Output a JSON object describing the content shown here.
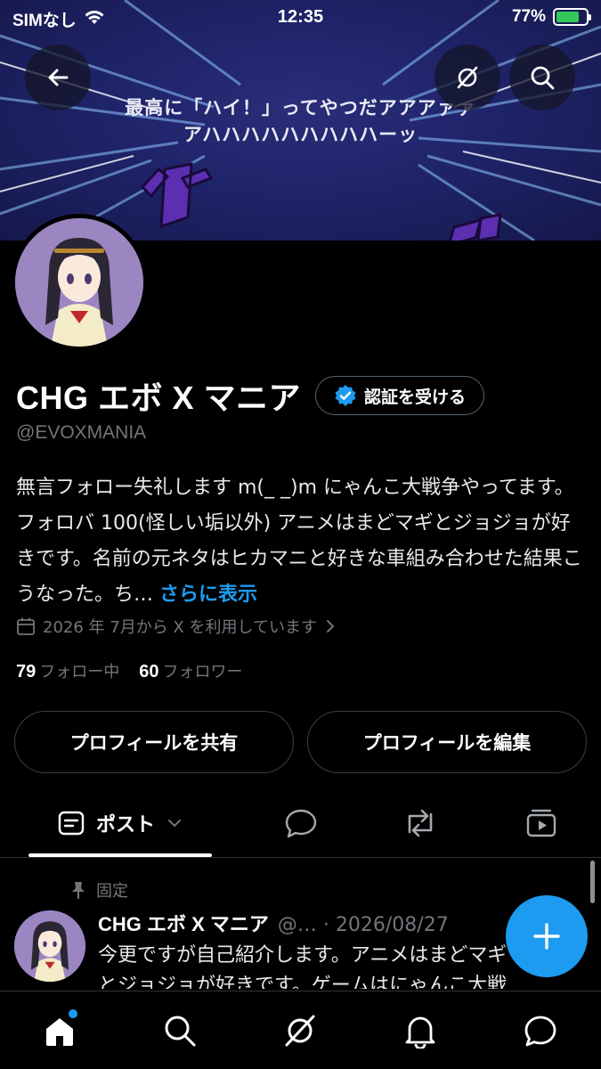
{
  "status_bar": {
    "carrier": "SIMなし",
    "time": "12:35",
    "battery": "77%",
    "battery_level": 0.77
  },
  "banner": {
    "line1": "最高に「ハイ！」ってやつだアアアァァ",
    "line2": "アハハハハハハハハハーッ",
    "sfx": "ドド"
  },
  "profile": {
    "display_name": "CHG エボ X マニア",
    "verify_label": "認証を受ける",
    "handle": "@EVOXMANIA",
    "bio": "無言フォロー失礼します m(_ _)m にゃんこ大戦争やってます。フォロバ 100(怪しい垢以外) アニメはまどマギとジョジョが好きです。名前の元ネタはヒカマニと好きな車組み合わせた結果こうなった。ち… ",
    "bio_more": "さらに表示",
    "joined": "2026 年 7月から X を利用しています",
    "following_count": "79",
    "following_label": "フォロー中",
    "followers_count": "60",
    "followers_label": "フォロワー",
    "share_button": "プロフィールを共有",
    "edit_button": "プロフィールを編集"
  },
  "tabs": {
    "active_label": "ポスト"
  },
  "post": {
    "pinned_label": "固定",
    "name": "CHG エボ X マニア",
    "meta": "@… · 2026/08/27",
    "text": "今更ですが自己紹介します。アニメはまどマギ\nとジョジョが好きです。ゲームはにゃんこ大戦"
  },
  "colors": {
    "accent": "#1d9bf0",
    "background": "#000000",
    "muted": "#71767b",
    "avatar_bg": "#9b86c2"
  },
  "icons": [
    "back-arrow-icon",
    "grok-icon",
    "search-icon",
    "verified-badge-icon",
    "calendar-icon",
    "pin-icon",
    "reply-icon",
    "repost-icon",
    "media-icon",
    "home-icon",
    "bell-icon",
    "message-icon",
    "plus-icon"
  ]
}
